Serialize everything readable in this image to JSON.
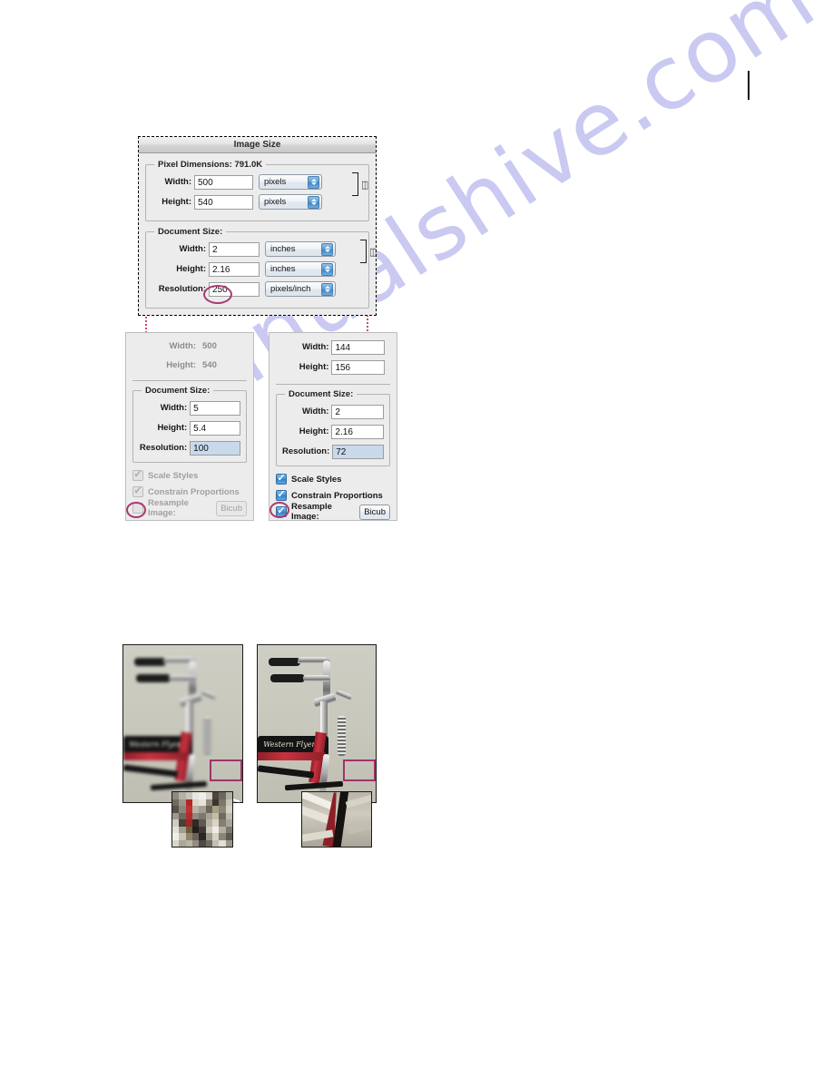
{
  "page": {
    "margin_mark": ""
  },
  "watermark": {
    "text": "manualshive.com"
  },
  "dialog": {
    "title": "Image Size",
    "pixel_dimensions": {
      "group_title": "Pixel Dimensions:  791.0K",
      "size_value": "791.0K",
      "rows": [
        {
          "label": "Width:",
          "value": "500",
          "unit": "pixels"
        },
        {
          "label": "Height:",
          "value": "540",
          "unit": "pixels"
        }
      ],
      "link_icon": "chain-link"
    },
    "document_size": {
      "group_title": "Document Size:",
      "rows": [
        {
          "label": "Width:",
          "value": "2",
          "unit": "inches"
        },
        {
          "label": "Height:",
          "value": "2.16",
          "unit": "inches"
        },
        {
          "label": "Resolution:",
          "value": "250",
          "unit": "pixels/inch"
        }
      ],
      "link_icon": "chain-link",
      "highlighted_field": "Resolution"
    }
  },
  "panel_left": {
    "pixel_rows": [
      {
        "label": "Width:",
        "value": "500"
      },
      {
        "label": "Height:",
        "value": "540"
      }
    ],
    "document_group_title": "Document Size:",
    "document_rows": [
      {
        "label": "Width:",
        "value": "5",
        "selected": false
      },
      {
        "label": "Height:",
        "value": "5.4",
        "selected": false
      },
      {
        "label": "Resolution:",
        "value": "100",
        "selected": true
      }
    ],
    "options": [
      {
        "label": "Scale Styles",
        "checked": true,
        "enabled": false
      },
      {
        "label": "Constrain Proportions",
        "checked": true,
        "enabled": false
      }
    ],
    "resample": {
      "label": "Resample Image:",
      "checked": false,
      "enabled": false,
      "method": "Bicub"
    }
  },
  "panel_right": {
    "pixel_rows": [
      {
        "label": "Width:",
        "value": "144"
      },
      {
        "label": "Height:",
        "value": "156"
      }
    ],
    "document_group_title": "Document Size:",
    "document_rows": [
      {
        "label": "Width:",
        "value": "2",
        "selected": false
      },
      {
        "label": "Height:",
        "value": "2.16",
        "selected": false
      },
      {
        "label": "Resolution:",
        "value": "72",
        "selected": true
      }
    ],
    "options": [
      {
        "label": "Scale Styles",
        "checked": true,
        "enabled": true
      },
      {
        "label": "Constrain Proportions",
        "checked": true,
        "enabled": true
      }
    ],
    "resample": {
      "label": "Resample Image:",
      "checked": true,
      "enabled": true,
      "method": "Bicub"
    }
  },
  "photos": {
    "left": {
      "caption": "",
      "brand_script": "Western Flyer",
      "quality": "low-resolution-resampled"
    },
    "right": {
      "caption": "",
      "brand_script": "Western Flyer",
      "quality": "high-resolution-original"
    }
  },
  "colors": {
    "annotation_red": "#d24a6a",
    "circle_magenta": "#a83a6d",
    "crop_magenta": "#a0336a",
    "watermark": "#c9c9f2",
    "dialog_bg": "#ececec",
    "accent_blue": "#3f8fd0"
  }
}
